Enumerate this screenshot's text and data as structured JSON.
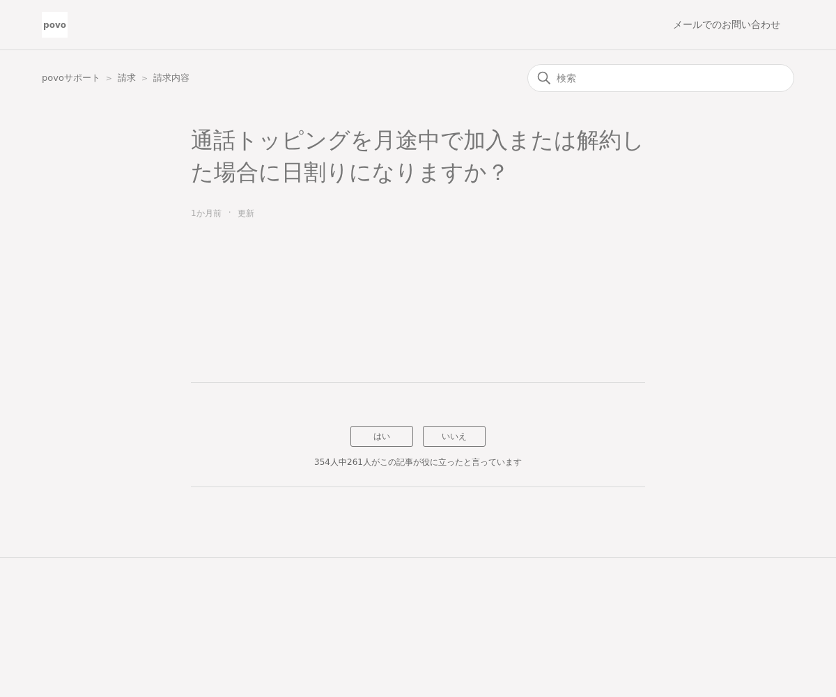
{
  "header": {
    "logo": "povo",
    "contact_link": "メールでのお問い合わせ"
  },
  "breadcrumbs": {
    "items": [
      "povoサポート",
      "請求",
      "請求内容"
    ],
    "separator": ">"
  },
  "search": {
    "placeholder": "検索"
  },
  "article": {
    "title": "通話トッピングを月途中で加入または解約した場合に日割りになりますか？",
    "meta": [
      "1か月前",
      "·",
      "更新"
    ]
  },
  "vote": {
    "buttons": [
      "はい",
      "いいえ"
    ],
    "summary": "354人中261人がこの記事が役に立ったと言っています"
  }
}
